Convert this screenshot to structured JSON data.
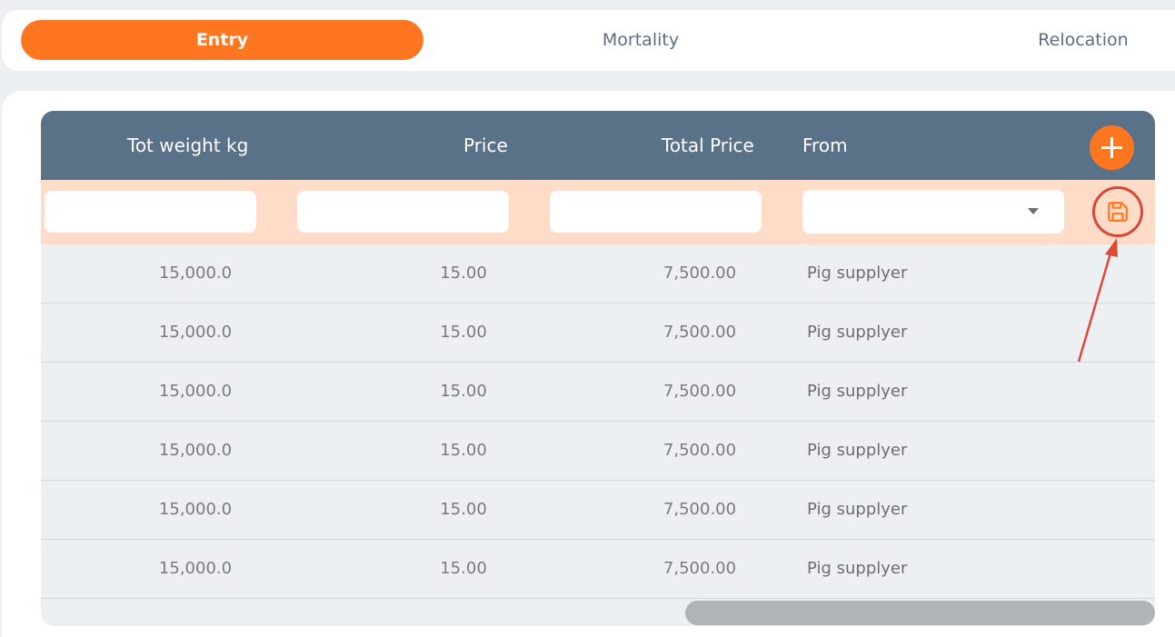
{
  "tabs": [
    {
      "label": "Entry",
      "active": true
    },
    {
      "label": "Mortality",
      "active": false
    },
    {
      "label": "Relocation",
      "active": false
    }
  ],
  "table": {
    "columns": [
      "Tot weight kg",
      "Price",
      "Total Price",
      "From"
    ],
    "rows": [
      [
        "15,000.0",
        "15.00",
        "7,500.00",
        "Pig supplyer"
      ],
      [
        "15,000.0",
        "15.00",
        "7,500.00",
        "Pig supplyer"
      ],
      [
        "15,000.0",
        "15.00",
        "7,500.00",
        "Pig supplyer"
      ],
      [
        "15,000.0",
        "15.00",
        "7,500.00",
        "Pig supplyer"
      ],
      [
        "15,000.0",
        "15.00",
        "7,500.00",
        "Pig supplyer"
      ],
      [
        "15,000.0",
        "15.00",
        "7,500.00",
        "Pig supplyer"
      ]
    ]
  },
  "entry_row": {
    "tot_weight_value": "",
    "price_value": "",
    "total_price_value": "",
    "from_selected": ""
  },
  "icons": {
    "add": "plus-icon",
    "save": "floppy-disk-icon",
    "dropdown": "caret-down-icon"
  },
  "colors": {
    "accent": "#ff7620",
    "header": "#5a7288",
    "entry_row_bg": "#ffdcc8",
    "annotation": "#d9473b"
  }
}
